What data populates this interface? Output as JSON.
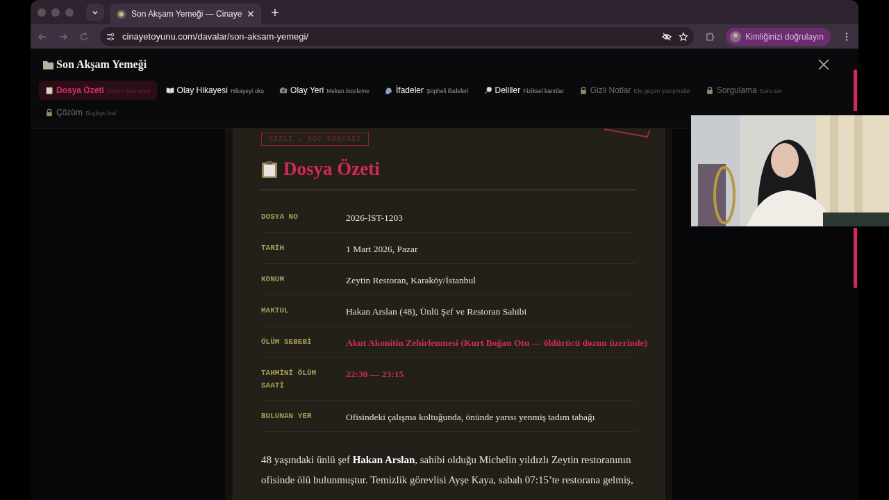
{
  "browser": {
    "tab": {
      "title": "Son Akşam Yemeği — Cinaye"
    },
    "address": "cinayetoyunu.com/davalar/son-aksam-yemegi/",
    "profile_button": "Kimliğinizi doğrulayın"
  },
  "header": {
    "title": "Son Akşam Yemeği"
  },
  "nav": [
    {
      "label": "Dosya Özeti",
      "sublabel": "Olayın kısa özeti",
      "selected": true,
      "locked": false
    },
    {
      "label": "Olay Hikayesi",
      "sublabel": "Hikayeyi oku",
      "selected": false,
      "locked": false
    },
    {
      "label": "Olay Yeri",
      "sublabel": "Mekan inceleme",
      "selected": false,
      "locked": false
    },
    {
      "label": "İfadeler",
      "sublabel": "Şüpheli ifadeleri",
      "selected": false,
      "locked": false
    },
    {
      "label": "Deliller",
      "sublabel": "Fiziksel kanıtlar",
      "selected": false,
      "locked": false
    },
    {
      "label": "Gizli Notlar",
      "sublabel": "Ele geçen yazışmalar",
      "selected": false,
      "locked": true
    },
    {
      "label": "Sorgulama",
      "sublabel": "Soru sor",
      "selected": false,
      "locked": true
    },
    {
      "label": "Çözüm",
      "sublabel": "Suçluyu bul",
      "selected": false,
      "locked": true
    }
  ],
  "card": {
    "stamp": "GİZLİ — SUÇ DOSYASI",
    "title": "Dosya Özeti",
    "rows": [
      {
        "label": "DOSYA NO",
        "value": "2026-İST-1203",
        "highlight": false
      },
      {
        "label": "TARİH",
        "value": "1 Mart 2026, Pazar",
        "highlight": false
      },
      {
        "label": "KONUM",
        "value": "Zeytin Restoran, Karaköy/İstanbul",
        "highlight": false
      },
      {
        "label": "MAKTUL",
        "value": "Hakan Arslan (48), Ünlü Şef ve Restoran Sahibi",
        "highlight": false
      },
      {
        "label": "ÖLÜM SEBEBİ",
        "value": "Akut Akonitin Zehirlenmesi (Kurt Boğan Otu — öldürücü dozun üzerinde)",
        "highlight": true
      },
      {
        "label": "TAHMİNİ ÖLÜM SAATİ",
        "value": "22:30 — 23:15",
        "highlight": true
      },
      {
        "label": "BULUNAN YER",
        "value": "Ofisindeki çalışma koltuğunda, önünde yarısı yenmiş tadım tabağı",
        "highlight": false
      }
    ],
    "paragraph": "48 yaşındaki ünlü şef **Hakan Arslan**, sahibi olduğu Michelin yıldızlı Zeytin restoranının ofisinde ölü bulunmuştur. Temizlik görevlisi Ayşe Kaya, sabah 07:15’te restorana gelmiş,"
  }
}
